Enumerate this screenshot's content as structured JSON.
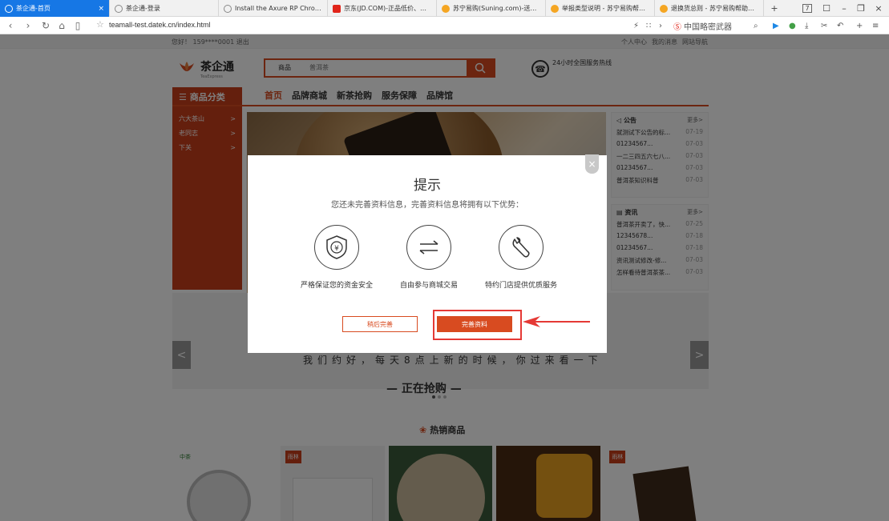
{
  "browser": {
    "tabs": [
      {
        "label": "茶企通-首页",
        "active": true,
        "favicon": "#ffffff"
      },
      {
        "label": "茶企通-登录",
        "active": false,
        "favicon": "#888888"
      },
      {
        "label": "Install the Axure RP Chrome Exte",
        "active": false,
        "favicon": "#888888"
      },
      {
        "label": "京东(JD.COM)-正品低价、品质保障",
        "active": false,
        "favicon": "#e1251b"
      },
      {
        "label": "苏宁易购(Suning.com)-送货更准时",
        "active": false,
        "favicon": "#f5a623"
      },
      {
        "label": "举报类型说明 - 苏宁易购帮助中心",
        "active": false,
        "favicon": "#f5a623"
      },
      {
        "label": "退换货总则 - 苏宁易购帮助中心",
        "active": false,
        "favicon": "#f5a623"
      }
    ],
    "tab_close": "×",
    "new_tab": "+",
    "tab_count": "7",
    "window_controls": {
      "restore": "☐",
      "minimize": "–",
      "maximize": "❐",
      "close": "×"
    },
    "url": "teamall-test.datek.cn/index.html",
    "search_engine": "中国略密武器",
    "nav_icons": [
      "back-icon",
      "forward-icon",
      "refresh-icon",
      "home-icon",
      "reader-icon",
      "star-icon"
    ]
  },
  "site": {
    "topbar": {
      "greeting": "您好！ 159****0001   退出",
      "links": [
        "个人中心",
        "我的消息",
        "网站导航"
      ]
    },
    "logo": {
      "name": "茶企通",
      "tagline": "TeaExpress"
    },
    "search": {
      "type_label": "商品",
      "placeholder": "普洱茶"
    },
    "hotline": "24小时全国服务热线",
    "category_title": "☰ 商品分类",
    "categories": [
      "六大茶山",
      "老同志",
      "下关"
    ],
    "category_arrow": ">",
    "nav": [
      "首页",
      "品牌商城",
      "新茶抢购",
      "服务保障",
      "品牌馆"
    ],
    "notice": {
      "title": "公告",
      "more": "更多>",
      "items": [
        {
          "text": "就测试下公告的标...",
          "date": "07-19"
        },
        {
          "text": "01234567...",
          "date": "07-03"
        },
        {
          "text": "一二三四五六七八...",
          "date": "07-03"
        },
        {
          "text": "01234567...",
          "date": "07-03"
        },
        {
          "text": "普洱茶知识科普",
          "date": "07-03"
        }
      ]
    },
    "news": {
      "title": "资讯",
      "more": "更多>",
      "items": [
        {
          "text": "普洱茶开卖了，快...",
          "date": "07-25"
        },
        {
          "text": "12345678...",
          "date": "07-18"
        },
        {
          "text": "01234567...",
          "date": "07-18"
        },
        {
          "text": "资讯测试修改-修...",
          "date": "07-03"
        },
        {
          "text": "怎样看待普洱茶茶...",
          "date": "07-03"
        }
      ]
    },
    "slogan": "我们约好，每天8点上新的时候，你过来看一下",
    "rush_title": "— 正在抢购 —",
    "hot_title": "热销商品",
    "carousel_prev": "<",
    "carousel_next": ">",
    "products": [
      {
        "brand": "中茶",
        "bg": "#ffffff"
      },
      {
        "brand": "雨林",
        "bg": "#f3f3f3"
      },
      {
        "brand": "",
        "bg": "#3a5a3a"
      },
      {
        "brand": "",
        "bg": "#4a2a12"
      },
      {
        "brand": "雨林",
        "bg": "#ffffff"
      }
    ]
  },
  "modal": {
    "title": "提示",
    "description": "您还未完善资料信息，完善资料信息将拥有以下优势：",
    "close": "×",
    "features": [
      {
        "label": "严格保证您的资金安全",
        "icon": "shield-yen-icon"
      },
      {
        "label": "自由参与商城交易",
        "icon": "exchange-arrows-icon"
      },
      {
        "label": "特约门店提供优质服务",
        "icon": "wrench-icon"
      }
    ],
    "later_button": "稍后完善",
    "complete_button": "完善资料"
  },
  "colors": {
    "brand": "#d84b20",
    "brand_dark": "#c93f1b",
    "annotation": "#e53935",
    "active_tab": "#1677e5"
  }
}
